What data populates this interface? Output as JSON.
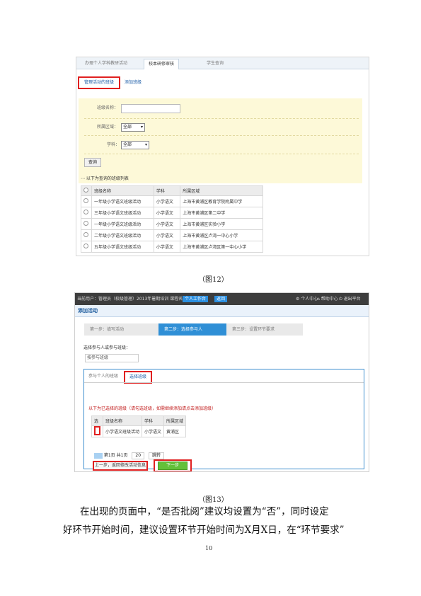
{
  "figure12": {
    "caption": "（图12）",
    "tabs": [
      "办理个人学科教研活动",
      "校本研修审核",
      "学生查询"
    ],
    "subtabs": {
      "active": "管理活动的班级",
      "other": "添加班级"
    },
    "form": {
      "name_label": "班级名称：",
      "region_label": "所属区域：",
      "region_value": "全部",
      "subject_label": "学科：",
      "subject_value": "全部",
      "query_button": "查询"
    },
    "list_title": "以下为查询的班级列表",
    "table": {
      "headers": [
        "班级名称",
        "学科",
        "所属区域"
      ],
      "rows": [
        [
          "一年级小学语文班级活动",
          "小学语文",
          "上海市黄浦区教育学院附属中学"
        ],
        [
          "三年级小学语文班级活动",
          "小学语文",
          "上海市黄浦区第二中学"
        ],
        [
          "一年级小学语文班级活动",
          "小学语文",
          "上海市黄浦区实验小学"
        ],
        [
          "二年级小学语文班级活动",
          "小学语文",
          "上海市黄浦区卢湾一中心小学"
        ],
        [
          "五年级小学语文班级活动",
          "小学语文",
          "上海市黄浦区卢湾区第一中心小学"
        ]
      ]
    }
  },
  "figure13": {
    "caption": "（图13）",
    "topbar": {
      "left": "当前用户：管理员（校级管理）2013年暑期培训 课程名称：  2013",
      "badge1": "个人工作台",
      "badge2": "返回",
      "right1": "个人中心",
      "right2": "帮助中心",
      "right3": "退出平台"
    },
    "header_title": "添加活动",
    "steps": [
      "第一步：填写活动",
      "第二步：选择参与人",
      "第三步：设置环节要求"
    ],
    "choose_label": "选择参与人或参与班级：",
    "choose_value": "按参与班级",
    "panel_tabs": [
      "参与个人的班级",
      "选择班级"
    ],
    "hint": "以下为已选择的班级（请勾选班级，如需继续添加请点击添加班级）",
    "table": {
      "headers": [
        "选",
        "班级名称",
        "学科",
        "所属区域"
      ],
      "row": [
        "小学语文班级活动",
        "小学语文",
        "黄浦区"
      ]
    },
    "pager": {
      "text": "第1页 共1页",
      "size": "20",
      "go": "跳转"
    },
    "btn_back": "上一步，返回修改活动信息",
    "btn_next": "下一步"
  },
  "body_text": {
    "line1": "在出现的页面中，“是否批阅”建议均设置为“否”，同时设定",
    "line2": "好环节开始时间，建议设置环节开始时间为X月X日，在“环节要求”"
  },
  "page_number": "10"
}
